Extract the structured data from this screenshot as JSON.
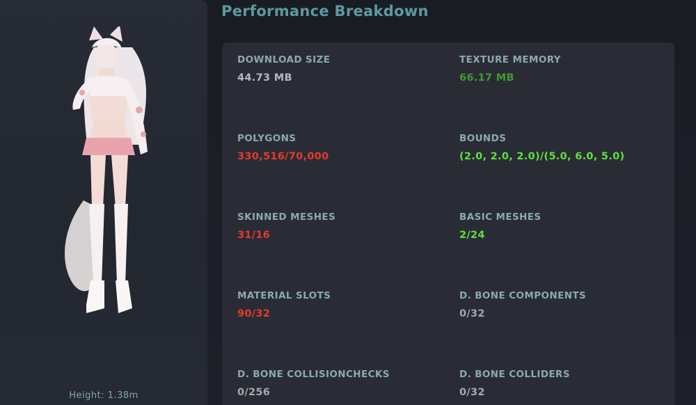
{
  "title": "Performance Breakdown",
  "preview": {
    "height_label": "Height: 1.38m"
  },
  "stats": [
    {
      "label": "DOWNLOAD SIZE",
      "value": "44.73 MB",
      "status": "neutral"
    },
    {
      "label": "TEXTURE MEMORY",
      "value": "66.17 MB",
      "status": "ok"
    },
    {
      "label": "POLYGONS",
      "value": "330,516/70,000",
      "status": "bad"
    },
    {
      "label": "BOUNDS",
      "value": "(2.0, 2.0, 2.0)/(5.0, 6.0, 5.0)",
      "status": "good"
    },
    {
      "label": "SKINNED MESHES",
      "value": "31/16",
      "status": "bad"
    },
    {
      "label": "BASIC MESHES",
      "value": "2/24",
      "status": "good"
    },
    {
      "label": "MATERIAL SLOTS",
      "value": "90/32",
      "status": "bad"
    },
    {
      "label": "D. BONE COMPONENTS",
      "value": "0/32",
      "status": "neutral"
    },
    {
      "label": "D. BONE COLLISIONCHECKS",
      "value": "0/256",
      "status": "neutral"
    },
    {
      "label": "D. BONE COLLIDERS",
      "value": "0/32",
      "status": "neutral"
    }
  ],
  "colors": {
    "neutral": "#b3b8c0",
    "ok": "#3e9c2e",
    "good": "#5fe23a",
    "bad": "#e8392a",
    "label": "#8aa9b2",
    "title": "#5b9aa0"
  }
}
